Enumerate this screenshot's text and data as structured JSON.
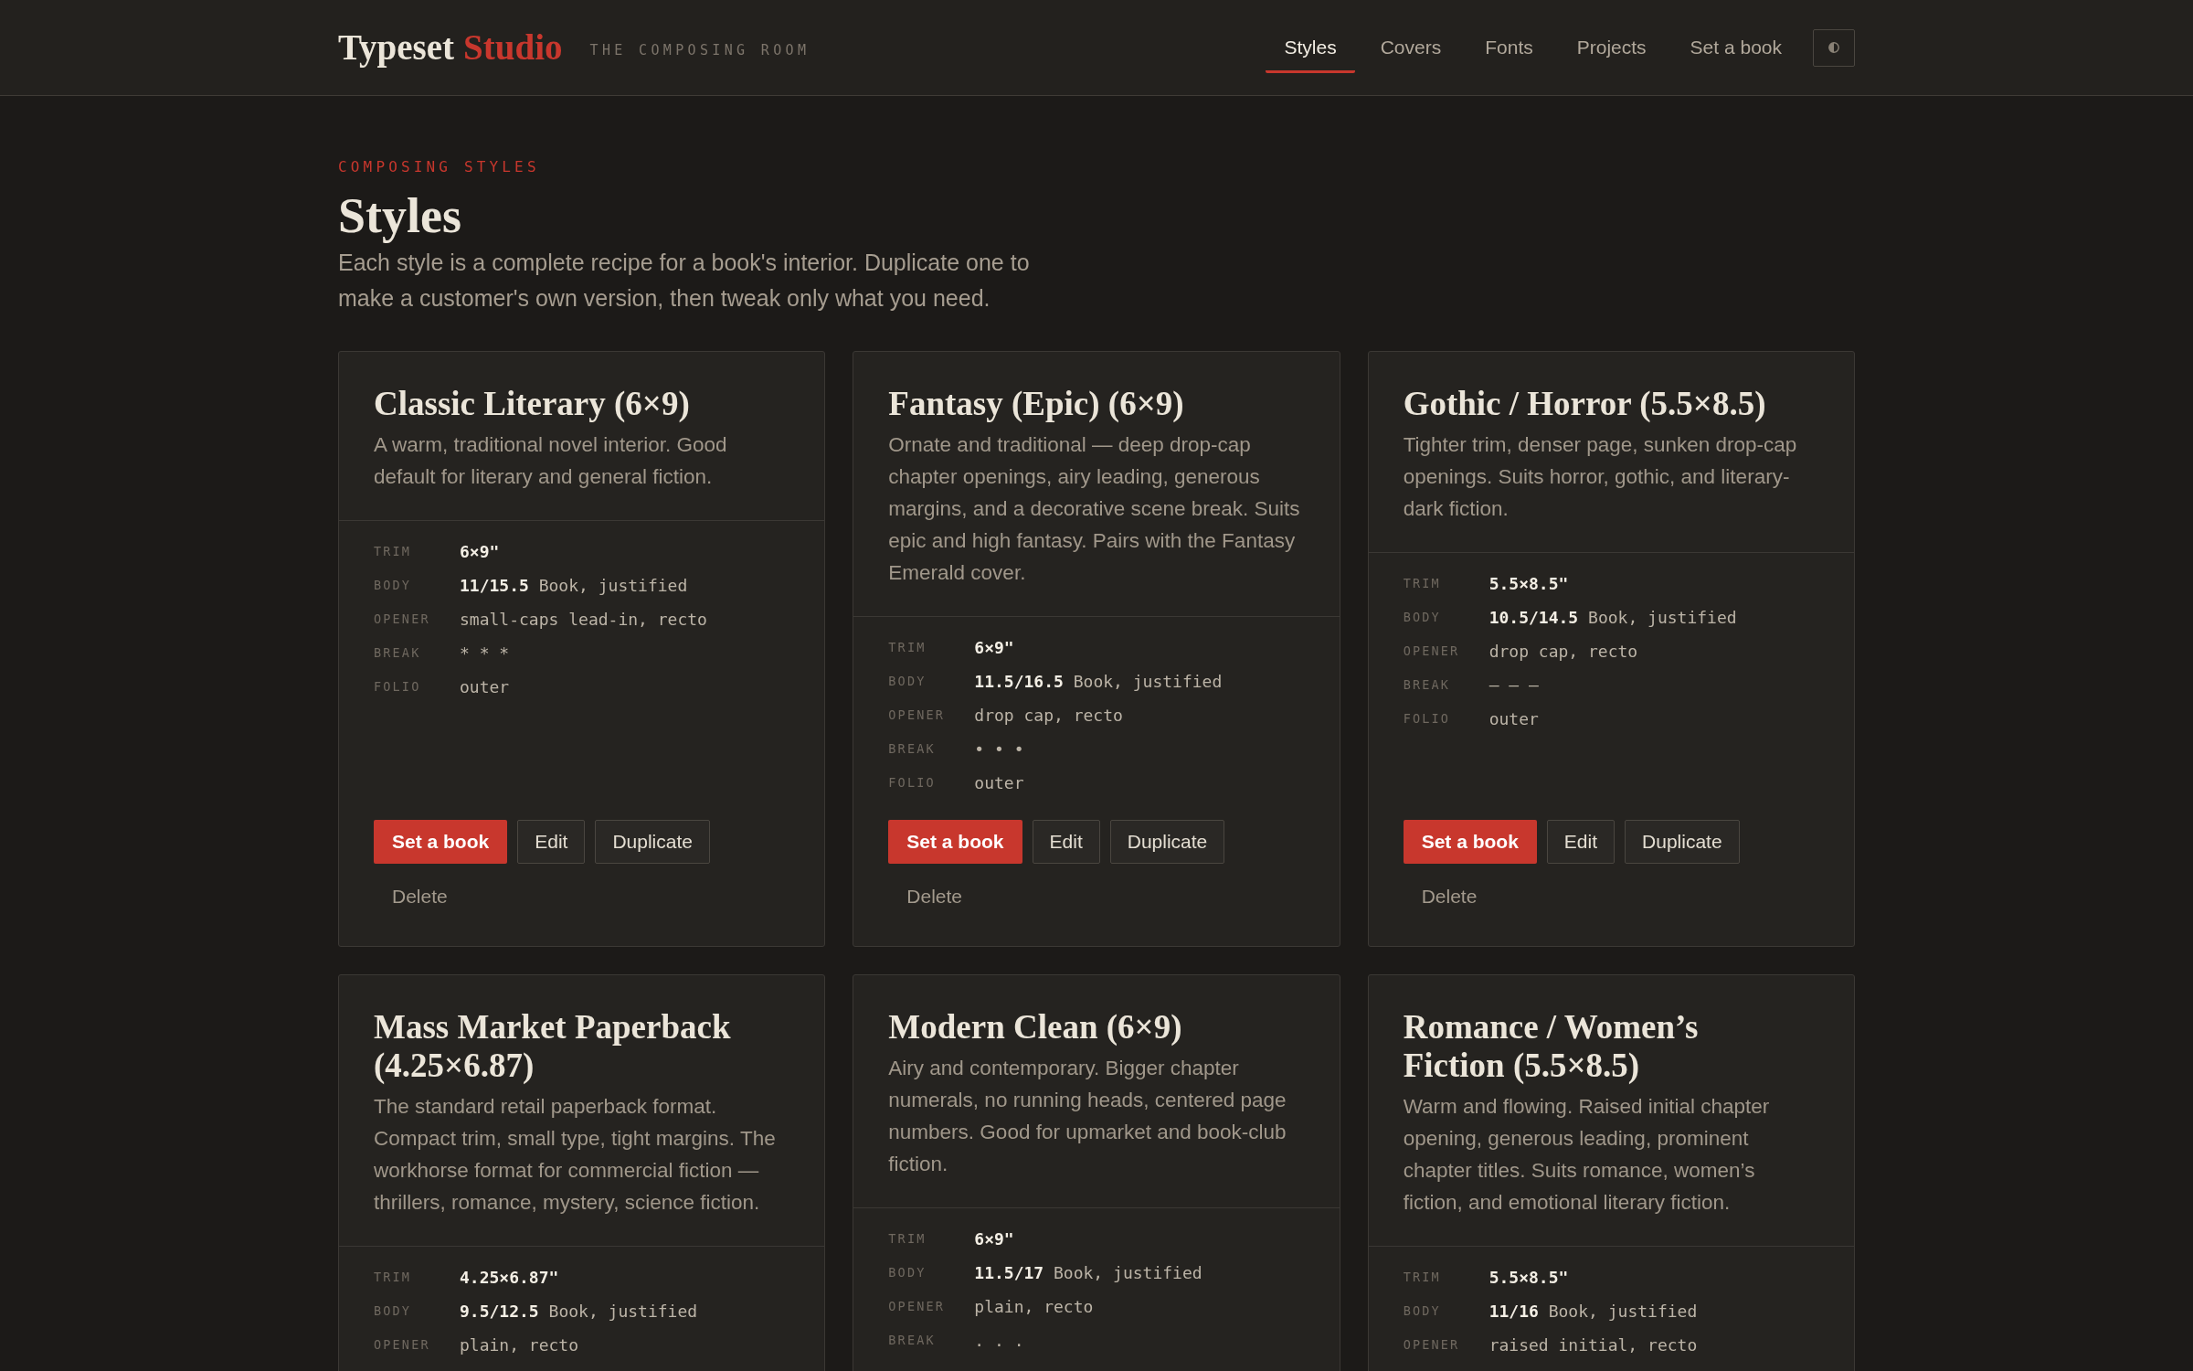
{
  "header": {
    "logo": {
      "text": "Typeset",
      "accent": "Studio"
    },
    "tagline": "THE COMPOSING ROOM",
    "nav": [
      {
        "label": "Styles",
        "selected": true
      },
      {
        "label": "Covers",
        "selected": false
      },
      {
        "label": "Fonts",
        "selected": false
      },
      {
        "label": "Projects",
        "selected": false
      },
      {
        "label": "Set a book",
        "selected": false
      }
    ]
  },
  "page": {
    "eyebrow": "COMPOSING STYLES",
    "title": "Styles",
    "intro": "Each style is a complete recipe for a book's interior. Duplicate one to make a customer's own version, then tweak only what you need."
  },
  "styles": [
    {
      "title": "Classic Literary (6×9)",
      "description": "A warm, traditional novel interior. Good default for literary and general fiction.",
      "specs": [
        {
          "label": "TRIM",
          "value": "6×9\"",
          "kind": "strong"
        },
        {
          "label": "BODY",
          "value": "**11/15.5** Book, justified",
          "kind": "plain"
        },
        {
          "label": "OPENER",
          "value": "small-caps lead-in, recto",
          "kind": "plain"
        },
        {
          "label": "BREAK",
          "value": "* * *",
          "kind": "plain"
        },
        {
          "label": "FOLIO",
          "value": "outer",
          "kind": "plain"
        }
      ],
      "actions": [
        {
          "label": "Set a book",
          "kind": "primary"
        },
        {
          "label": "Edit",
          "kind": "secondary"
        },
        {
          "label": "Duplicate",
          "kind": "secondary"
        },
        {
          "label": "Delete",
          "kind": "ghost"
        }
      ]
    },
    {
      "title": "Fantasy (Epic) (6×9)",
      "description": "Ornate and traditional — deep drop-cap chapter openings, airy leading, generous margins, and a decorative scene break. Suits epic and high fantasy. Pairs with the Fantasy Emerald cover.",
      "specs": [
        {
          "label": "TRIM",
          "value": "6×9\"",
          "kind": "strong"
        },
        {
          "label": "BODY",
          "value": "**11.5/16.5** Book, justified",
          "kind": "plain"
        },
        {
          "label": "OPENER",
          "value": "drop cap, recto",
          "kind": "plain"
        },
        {
          "label": "BREAK",
          "value": "• • •",
          "kind": "plain"
        },
        {
          "label": "FOLIO",
          "value": "outer",
          "kind": "plain"
        }
      ],
      "actions": [
        {
          "label": "Set a book",
          "kind": "primary"
        },
        {
          "label": "Edit",
          "kind": "secondary"
        },
        {
          "label": "Duplicate",
          "kind": "secondary"
        },
        {
          "label": "Delete",
          "kind": "ghost"
        }
      ]
    },
    {
      "title": "Gothic / Horror (5.5×8.5)",
      "description": "Tighter trim, denser page, sunken drop-cap openings. Suits horror, gothic, and literary-dark fiction.",
      "specs": [
        {
          "label": "TRIM",
          "value": "5.5×8.5\"",
          "kind": "strong"
        },
        {
          "label": "BODY",
          "value": "**10.5/14.5** Book, justified",
          "kind": "plain"
        },
        {
          "label": "OPENER",
          "value": "drop cap, recto",
          "kind": "plain"
        },
        {
          "label": "BREAK",
          "value": "— — —",
          "kind": "plain"
        },
        {
          "label": "FOLIO",
          "value": "outer",
          "kind": "plain"
        }
      ],
      "actions": [
        {
          "label": "Set a book",
          "kind": "primary"
        },
        {
          "label": "Edit",
          "kind": "secondary"
        },
        {
          "label": "Duplicate",
          "kind": "secondary"
        },
        {
          "label": "Delete",
          "kind": "ghost"
        }
      ]
    },
    {
      "title": "Mass Market Paperback (4.25×6.87)",
      "description": "The standard retail paperback format. Compact trim, small type, tight margins. The workhorse format for commercial fiction — thrillers, romance, mystery, science fiction.",
      "specs": [
        {
          "label": "TRIM",
          "value": "4.25×6.87\"",
          "kind": "strong"
        },
        {
          "label": "BODY",
          "value": "**9.5/12.5** Book, justified",
          "kind": "plain"
        },
        {
          "label": "OPENER",
          "value": "plain, recto",
          "kind": "plain"
        }
      ]
    },
    {
      "title": "Modern Clean (6×9)",
      "description": "Airy and contemporary. Bigger chapter numerals, no running heads, centered page numbers. Good for upmarket and book-club fiction.",
      "specs": [
        {
          "label": "TRIM",
          "value": "6×9\"",
          "kind": "strong"
        },
        {
          "label": "BODY",
          "value": "**11.5/17** Book, justified",
          "kind": "plain"
        },
        {
          "label": "OPENER",
          "value": "plain, recto",
          "kind": "plain"
        },
        {
          "label": "BREAK",
          "value": ". . .",
          "kind": "plain"
        }
      ]
    },
    {
      "title": "Romance / Women’s Fiction (5.5×8.5)",
      "description": "Warm and flowing. Raised initial chapter opening, generous leading, prominent chapter titles. Suits romance, women’s fiction, and emotional literary fiction.",
      "specs": [
        {
          "label": "TRIM",
          "value": "5.5×8.5\"",
          "kind": "strong"
        },
        {
          "label": "BODY",
          "value": "**11/16** Book, justified",
          "kind": "plain"
        },
        {
          "label": "OPENER",
          "value": "raised initial, recto",
          "kind": "plain"
        }
      ]
    }
  ]
}
